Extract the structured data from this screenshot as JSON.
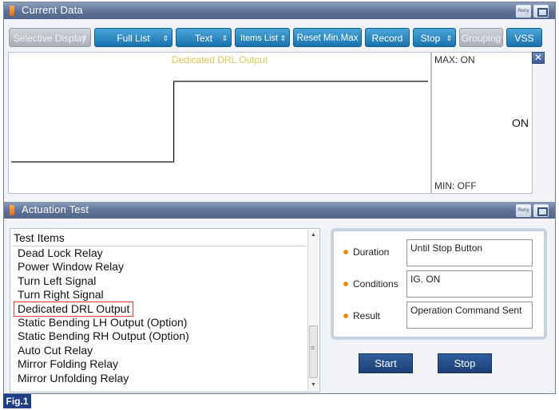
{
  "current_data": {
    "title": "Current Data",
    "retry_label": "Retry",
    "toolbar": {
      "selective_display": "Selective Display",
      "full_list": "Full List",
      "text": "Text",
      "items_list": "Items List",
      "reset_min_max": "Reset Min.Max",
      "record": "Record",
      "stop": "Stop",
      "grouping": "Grouping",
      "vss": "VSS"
    },
    "graph": {
      "signal_name": "Dedicated DRL Output",
      "max_label": "MAX: ON",
      "min_label": "MIN: OFF",
      "current_value": "ON",
      "trace": [
        {
          "t": 0,
          "state": "OFF"
        },
        {
          "t": 0.39,
          "state": "OFF"
        },
        {
          "t": 0.39,
          "state": "ON"
        },
        {
          "t": 1,
          "state": "ON"
        }
      ]
    }
  },
  "actuation_test": {
    "title": "Actuation Test",
    "retry_label": "Retry",
    "list_header": "Test Items",
    "items": [
      {
        "label": "Dead Lock Relay"
      },
      {
        "label": "Power Window Relay"
      },
      {
        "label": "Turn Left Signal"
      },
      {
        "label": "Turn Right Signal"
      },
      {
        "label": "Dedicated DRL Output",
        "selected": true
      },
      {
        "label": "Static Bending LH Output (Option)"
      },
      {
        "label": "Static Bending RH Output (Option)"
      },
      {
        "label": "Auto Cut Relay"
      },
      {
        "label": "Mirror Folding Relay"
      },
      {
        "label": "Mirror Unfolding Relay"
      }
    ],
    "info": {
      "duration_label": "Duration",
      "duration_value": "Until Stop Button",
      "conditions_label": "Conditions",
      "conditions_value": "IG. ON",
      "result_label": "Result",
      "result_value": "Operation Command Sent"
    },
    "start_label": "Start",
    "stop_label": "Stop"
  },
  "figure_label": "Fig.1",
  "colors": {
    "accent": "#1a72ad",
    "title_bar": "#5d7196",
    "selected_outline": "#e03b2f",
    "signal_label": "#e0c45a",
    "bullet": "#f08a1e"
  }
}
